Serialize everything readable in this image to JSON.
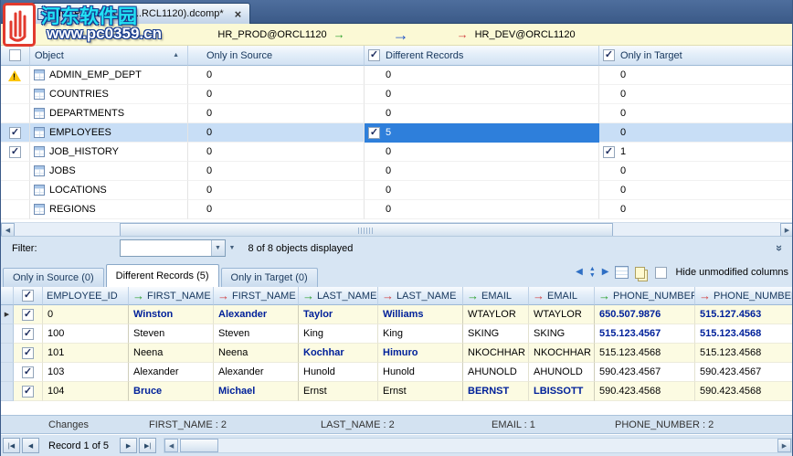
{
  "watermark": {
    "site_name": "河东软件园",
    "site_url": "www.pc0359.cn"
  },
  "document_tab": {
    "title": "HR_PROD vs HR...RCL1120).dcomp*"
  },
  "connection_bar": {
    "source": "HR_PROD@ORCL1120",
    "target": "HR_DEV@ORCL1120"
  },
  "icons": {
    "close": "×",
    "check": "✓",
    "sort_asc": "▲",
    "dropdown": "▼",
    "scroll_left": "◀",
    "scroll_right": "▶",
    "collapse": "»",
    "arrow_right": "→",
    "nav_first": "|◀",
    "nav_prev": "◀",
    "nav_next": "▶",
    "nav_last": "▶|",
    "row_marker": "▶",
    "warning": "!"
  },
  "objects_grid": {
    "headers": {
      "object": "Object",
      "only_in_source": "Only in Source",
      "different_records": "Different Records",
      "only_in_target": "Only in Target",
      "select_all_checked": false,
      "different_records_checked": true,
      "only_in_target_checked": true
    },
    "rows": [
      {
        "object": "ADMIN_EMP_DEPT",
        "warning": true,
        "checked": false,
        "selected": false,
        "only_in_source": "0",
        "different_records": "0",
        "dr_checked": false,
        "dr_selected": false,
        "only_in_target": "0",
        "oit_checked": false
      },
      {
        "object": "COUNTRIES",
        "warning": false,
        "checked": false,
        "selected": false,
        "only_in_source": "0",
        "different_records": "0",
        "dr_checked": false,
        "dr_selected": false,
        "only_in_target": "0",
        "oit_checked": false
      },
      {
        "object": "DEPARTMENTS",
        "warning": false,
        "checked": false,
        "selected": false,
        "only_in_source": "0",
        "different_records": "0",
        "dr_checked": false,
        "dr_selected": false,
        "only_in_target": "0",
        "oit_checked": false
      },
      {
        "object": "EMPLOYEES",
        "warning": false,
        "checked": true,
        "selected": true,
        "only_in_source": "0",
        "different_records": "5",
        "dr_checked": true,
        "dr_selected": true,
        "only_in_target": "0",
        "oit_checked": false
      },
      {
        "object": "JOB_HISTORY",
        "warning": false,
        "checked": true,
        "selected": false,
        "only_in_source": "0",
        "different_records": "0",
        "dr_checked": false,
        "dr_selected": false,
        "only_in_target": "1",
        "oit_checked": true
      },
      {
        "object": "JOBS",
        "warning": false,
        "checked": false,
        "selected": false,
        "only_in_source": "0",
        "different_records": "0",
        "dr_checked": false,
        "dr_selected": false,
        "only_in_target": "0",
        "oit_checked": false
      },
      {
        "object": "LOCATIONS",
        "warning": false,
        "checked": false,
        "selected": false,
        "only_in_source": "0",
        "different_records": "0",
        "dr_checked": false,
        "dr_selected": false,
        "only_in_target": "0",
        "oit_checked": false
      },
      {
        "object": "REGIONS",
        "warning": false,
        "checked": false,
        "selected": false,
        "only_in_source": "0",
        "different_records": "0",
        "dr_checked": false,
        "dr_selected": false,
        "only_in_target": "0",
        "oit_checked": false
      }
    ]
  },
  "filter_bar": {
    "label": "Filter:",
    "combo_value": "",
    "status": "8 of 8 objects displayed"
  },
  "results_tabs": {
    "tabs": [
      {
        "label": "Only in Source (0)",
        "active": false
      },
      {
        "label": "Different Records (5)",
        "active": true
      },
      {
        "label": "Only in Target (0)",
        "active": false
      }
    ],
    "hide_unmodified_label": "Hide unmodified columns",
    "hide_unmodified_checked": false
  },
  "records_grid": {
    "select_all_checked": true,
    "id_header": "EMPLOYEE_ID",
    "pair_headers": [
      "FIRST_NAME",
      "LAST_NAME",
      "EMAIL",
      "PHONE_NUMBER"
    ],
    "rows": [
      {
        "checked": true,
        "selected": true,
        "id": "0",
        "cells": [
          {
            "s": "Winston",
            "t": "Alexander",
            "changed": true
          },
          {
            "s": "Taylor",
            "t": "Williams",
            "changed": true
          },
          {
            "s": "WTAYLOR",
            "t": "WTAYLOR",
            "changed": false
          },
          {
            "s": "650.507.9876",
            "t": "515.127.4563",
            "changed": true
          }
        ]
      },
      {
        "checked": true,
        "selected": false,
        "id": "100",
        "cells": [
          {
            "s": "Steven",
            "t": "Steven",
            "changed": false
          },
          {
            "s": "King",
            "t": "King",
            "changed": false
          },
          {
            "s": "SKING",
            "t": "SKING",
            "changed": false
          },
          {
            "s": "515.123.4567",
            "t": "515.123.4568",
            "changed": true
          }
        ]
      },
      {
        "checked": true,
        "selected": false,
        "id": "101",
        "cells": [
          {
            "s": "Neena",
            "t": "Neena",
            "changed": false
          },
          {
            "s": "Kochhar",
            "t": "Himuro",
            "changed": true
          },
          {
            "s": "NKOCHHAR",
            "t": "NKOCHHAR",
            "changed": false
          },
          {
            "s": "515.123.4568",
            "t": "515.123.4568",
            "changed": false
          }
        ]
      },
      {
        "checked": true,
        "selected": false,
        "id": "103",
        "cells": [
          {
            "s": "Alexander",
            "t": "Alexander",
            "changed": false
          },
          {
            "s": "Hunold",
            "t": "Hunold",
            "changed": false
          },
          {
            "s": "AHUNOLD",
            "t": "AHUNOLD",
            "changed": false
          },
          {
            "s": "590.423.4567",
            "t": "590.423.4567",
            "changed": false
          }
        ]
      },
      {
        "checked": true,
        "selected": false,
        "id": "104",
        "cells": [
          {
            "s": "Bruce",
            "t": "Michael",
            "changed": true
          },
          {
            "s": "Ernst",
            "t": "Ernst",
            "changed": false
          },
          {
            "s": "BERNST",
            "t": "LBISSOTT",
            "changed": true
          },
          {
            "s": "590.423.4568",
            "t": "590.423.4568",
            "changed": false
          }
        ]
      }
    ]
  },
  "summary_bar": {
    "label": "Changes",
    "items": [
      "FIRST_NAME : 2",
      "LAST_NAME : 2",
      "EMAIL : 1",
      "PHONE_NUMBER : 2"
    ]
  },
  "status_bar": {
    "record_text": "Record 1 of 5"
  }
}
